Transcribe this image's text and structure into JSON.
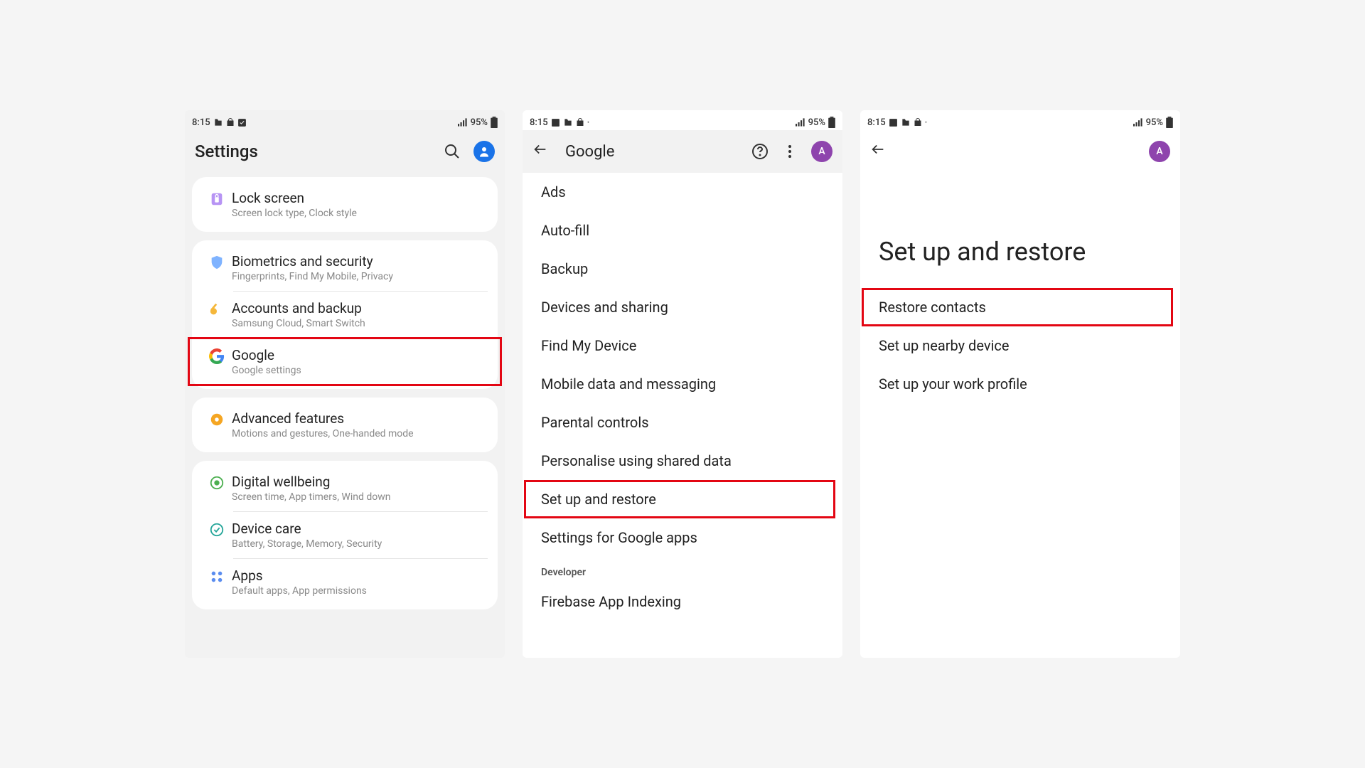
{
  "status": {
    "time": "8:15",
    "battery": "95%"
  },
  "colors": {
    "highlight": "#e30613",
    "avatar_blue": "#1a73e8",
    "avatar_purple": "#8e44ad"
  },
  "screen1": {
    "title": "Settings",
    "groups": [
      {
        "items": [
          {
            "title": "Lock screen",
            "sub": "Screen lock type, Clock style",
            "icon": "lock-icon"
          }
        ]
      },
      {
        "items": [
          {
            "title": "Biometrics and security",
            "sub": "Fingerprints, Find My Mobile, Privacy",
            "icon": "shield-icon"
          },
          {
            "title": "Accounts and backup",
            "sub": "Samsung Cloud, Smart Switch",
            "icon": "key-icon"
          },
          {
            "title": "Google",
            "sub": "Google settings",
            "icon": "google-icon",
            "highlight": true
          }
        ]
      },
      {
        "items": [
          {
            "title": "Advanced features",
            "sub": "Motions and gestures, One-handed mode",
            "icon": "gear-plus-icon"
          }
        ]
      },
      {
        "items": [
          {
            "title": "Digital wellbeing",
            "sub": "Screen time, App timers, Wind down",
            "icon": "wellbeing-icon"
          },
          {
            "title": "Device care",
            "sub": "Battery, Storage, Memory, Security",
            "icon": "device-care-icon"
          },
          {
            "title": "Apps",
            "sub": "Default apps, App permissions",
            "icon": "apps-icon"
          }
        ]
      }
    ]
  },
  "screen2": {
    "title": "Google",
    "avatar_letter": "A",
    "items": [
      {
        "label": "Ads"
      },
      {
        "label": "Auto-fill"
      },
      {
        "label": "Backup"
      },
      {
        "label": "Devices and sharing"
      },
      {
        "label": "Find My Device"
      },
      {
        "label": "Mobile data and messaging"
      },
      {
        "label": "Parental controls"
      },
      {
        "label": "Personalise using shared data"
      },
      {
        "label": "Set up and restore",
        "highlight": true
      },
      {
        "label": "Settings for Google apps"
      }
    ],
    "section_header": "Developer",
    "items2": [
      {
        "label": "Firebase App Indexing"
      }
    ]
  },
  "screen3": {
    "avatar_letter": "A",
    "title": "Set up and restore",
    "items": [
      {
        "label": "Restore contacts",
        "highlight": true
      },
      {
        "label": "Set up nearby device"
      },
      {
        "label": "Set up your work profile"
      }
    ]
  }
}
